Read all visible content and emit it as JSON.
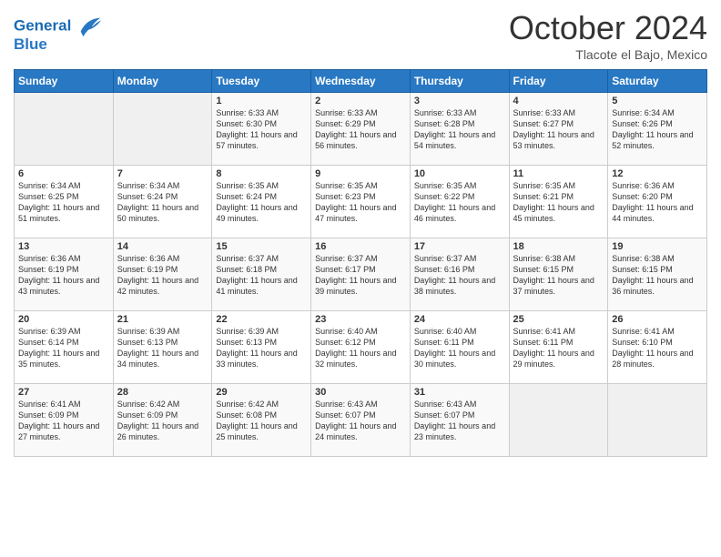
{
  "header": {
    "logo_line1": "General",
    "logo_line2": "Blue",
    "month_title": "October 2024",
    "location": "Tlacote el Bajo, Mexico"
  },
  "weekdays": [
    "Sunday",
    "Monday",
    "Tuesday",
    "Wednesday",
    "Thursday",
    "Friday",
    "Saturday"
  ],
  "weeks": [
    [
      {
        "day": "",
        "empty": true
      },
      {
        "day": "",
        "empty": true
      },
      {
        "day": "1",
        "sunrise": "Sunrise: 6:33 AM",
        "sunset": "Sunset: 6:30 PM",
        "daylight": "Daylight: 11 hours and 57 minutes."
      },
      {
        "day": "2",
        "sunrise": "Sunrise: 6:33 AM",
        "sunset": "Sunset: 6:29 PM",
        "daylight": "Daylight: 11 hours and 56 minutes."
      },
      {
        "day": "3",
        "sunrise": "Sunrise: 6:33 AM",
        "sunset": "Sunset: 6:28 PM",
        "daylight": "Daylight: 11 hours and 54 minutes."
      },
      {
        "day": "4",
        "sunrise": "Sunrise: 6:33 AM",
        "sunset": "Sunset: 6:27 PM",
        "daylight": "Daylight: 11 hours and 53 minutes."
      },
      {
        "day": "5",
        "sunrise": "Sunrise: 6:34 AM",
        "sunset": "Sunset: 6:26 PM",
        "daylight": "Daylight: 11 hours and 52 minutes."
      }
    ],
    [
      {
        "day": "6",
        "sunrise": "Sunrise: 6:34 AM",
        "sunset": "Sunset: 6:25 PM",
        "daylight": "Daylight: 11 hours and 51 minutes."
      },
      {
        "day": "7",
        "sunrise": "Sunrise: 6:34 AM",
        "sunset": "Sunset: 6:24 PM",
        "daylight": "Daylight: 11 hours and 50 minutes."
      },
      {
        "day": "8",
        "sunrise": "Sunrise: 6:35 AM",
        "sunset": "Sunset: 6:24 PM",
        "daylight": "Daylight: 11 hours and 49 minutes."
      },
      {
        "day": "9",
        "sunrise": "Sunrise: 6:35 AM",
        "sunset": "Sunset: 6:23 PM",
        "daylight": "Daylight: 11 hours and 47 minutes."
      },
      {
        "day": "10",
        "sunrise": "Sunrise: 6:35 AM",
        "sunset": "Sunset: 6:22 PM",
        "daylight": "Daylight: 11 hours and 46 minutes."
      },
      {
        "day": "11",
        "sunrise": "Sunrise: 6:35 AM",
        "sunset": "Sunset: 6:21 PM",
        "daylight": "Daylight: 11 hours and 45 minutes."
      },
      {
        "day": "12",
        "sunrise": "Sunrise: 6:36 AM",
        "sunset": "Sunset: 6:20 PM",
        "daylight": "Daylight: 11 hours and 44 minutes."
      }
    ],
    [
      {
        "day": "13",
        "sunrise": "Sunrise: 6:36 AM",
        "sunset": "Sunset: 6:19 PM",
        "daylight": "Daylight: 11 hours and 43 minutes."
      },
      {
        "day": "14",
        "sunrise": "Sunrise: 6:36 AM",
        "sunset": "Sunset: 6:19 PM",
        "daylight": "Daylight: 11 hours and 42 minutes."
      },
      {
        "day": "15",
        "sunrise": "Sunrise: 6:37 AM",
        "sunset": "Sunset: 6:18 PM",
        "daylight": "Daylight: 11 hours and 41 minutes."
      },
      {
        "day": "16",
        "sunrise": "Sunrise: 6:37 AM",
        "sunset": "Sunset: 6:17 PM",
        "daylight": "Daylight: 11 hours and 39 minutes."
      },
      {
        "day": "17",
        "sunrise": "Sunrise: 6:37 AM",
        "sunset": "Sunset: 6:16 PM",
        "daylight": "Daylight: 11 hours and 38 minutes."
      },
      {
        "day": "18",
        "sunrise": "Sunrise: 6:38 AM",
        "sunset": "Sunset: 6:15 PM",
        "daylight": "Daylight: 11 hours and 37 minutes."
      },
      {
        "day": "19",
        "sunrise": "Sunrise: 6:38 AM",
        "sunset": "Sunset: 6:15 PM",
        "daylight": "Daylight: 11 hours and 36 minutes."
      }
    ],
    [
      {
        "day": "20",
        "sunrise": "Sunrise: 6:39 AM",
        "sunset": "Sunset: 6:14 PM",
        "daylight": "Daylight: 11 hours and 35 minutes."
      },
      {
        "day": "21",
        "sunrise": "Sunrise: 6:39 AM",
        "sunset": "Sunset: 6:13 PM",
        "daylight": "Daylight: 11 hours and 34 minutes."
      },
      {
        "day": "22",
        "sunrise": "Sunrise: 6:39 AM",
        "sunset": "Sunset: 6:13 PM",
        "daylight": "Daylight: 11 hours and 33 minutes."
      },
      {
        "day": "23",
        "sunrise": "Sunrise: 6:40 AM",
        "sunset": "Sunset: 6:12 PM",
        "daylight": "Daylight: 11 hours and 32 minutes."
      },
      {
        "day": "24",
        "sunrise": "Sunrise: 6:40 AM",
        "sunset": "Sunset: 6:11 PM",
        "daylight": "Daylight: 11 hours and 30 minutes."
      },
      {
        "day": "25",
        "sunrise": "Sunrise: 6:41 AM",
        "sunset": "Sunset: 6:11 PM",
        "daylight": "Daylight: 11 hours and 29 minutes."
      },
      {
        "day": "26",
        "sunrise": "Sunrise: 6:41 AM",
        "sunset": "Sunset: 6:10 PM",
        "daylight": "Daylight: 11 hours and 28 minutes."
      }
    ],
    [
      {
        "day": "27",
        "sunrise": "Sunrise: 6:41 AM",
        "sunset": "Sunset: 6:09 PM",
        "daylight": "Daylight: 11 hours and 27 minutes."
      },
      {
        "day": "28",
        "sunrise": "Sunrise: 6:42 AM",
        "sunset": "Sunset: 6:09 PM",
        "daylight": "Daylight: 11 hours and 26 minutes."
      },
      {
        "day": "29",
        "sunrise": "Sunrise: 6:42 AM",
        "sunset": "Sunset: 6:08 PM",
        "daylight": "Daylight: 11 hours and 25 minutes."
      },
      {
        "day": "30",
        "sunrise": "Sunrise: 6:43 AM",
        "sunset": "Sunset: 6:07 PM",
        "daylight": "Daylight: 11 hours and 24 minutes."
      },
      {
        "day": "31",
        "sunrise": "Sunrise: 6:43 AM",
        "sunset": "Sunset: 6:07 PM",
        "daylight": "Daylight: 11 hours and 23 minutes."
      },
      {
        "day": "",
        "empty": true
      },
      {
        "day": "",
        "empty": true
      }
    ]
  ]
}
